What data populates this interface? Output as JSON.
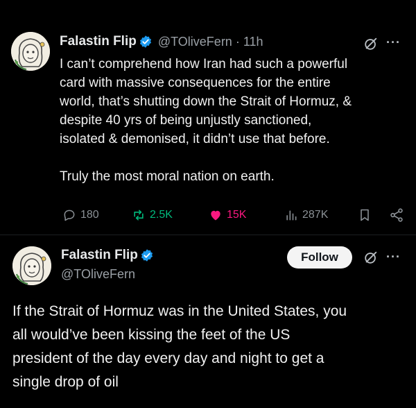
{
  "tweet1": {
    "author_name": "Falastin Flip",
    "handle_time": "@TOliveFern · 11h",
    "text_lines": [
      "I can’t comprehend how Iran had such a powerful",
      "card with massive consequences for the entire",
      "world, that’s shutting down the Strait of Hormuz, &",
      "despite 40 yrs of being unjustly sanctioned,",
      "isolated & demonised, it didn’t use that before."
    ],
    "closing_line": "Truly the most moral nation on earth.",
    "replies": "180",
    "reposts": "2.5K",
    "likes": "15K",
    "views": "287K",
    "like_color": "#f91880"
  },
  "tweet2": {
    "author_name": "Falastin Flip",
    "handle": "@TOliveFern",
    "follow_label": "Follow",
    "text_lines": [
      "If the Strait of Hormuz was in the United States, you",
      "all would’ve been kissing the feet of the US",
      "president of the day every day and night to get a",
      "single drop of oil"
    ]
  },
  "icons": {
    "verified": "verified-badge-icon",
    "grok": "grok-icon",
    "more": "more-icon",
    "reply": "reply-icon",
    "repost": "repost-icon",
    "like": "heart-icon",
    "views": "views-icon",
    "bookmark": "bookmark-icon",
    "share": "share-icon"
  },
  "more_glyph": "···",
  "accent_verified": "#1d9bf0"
}
